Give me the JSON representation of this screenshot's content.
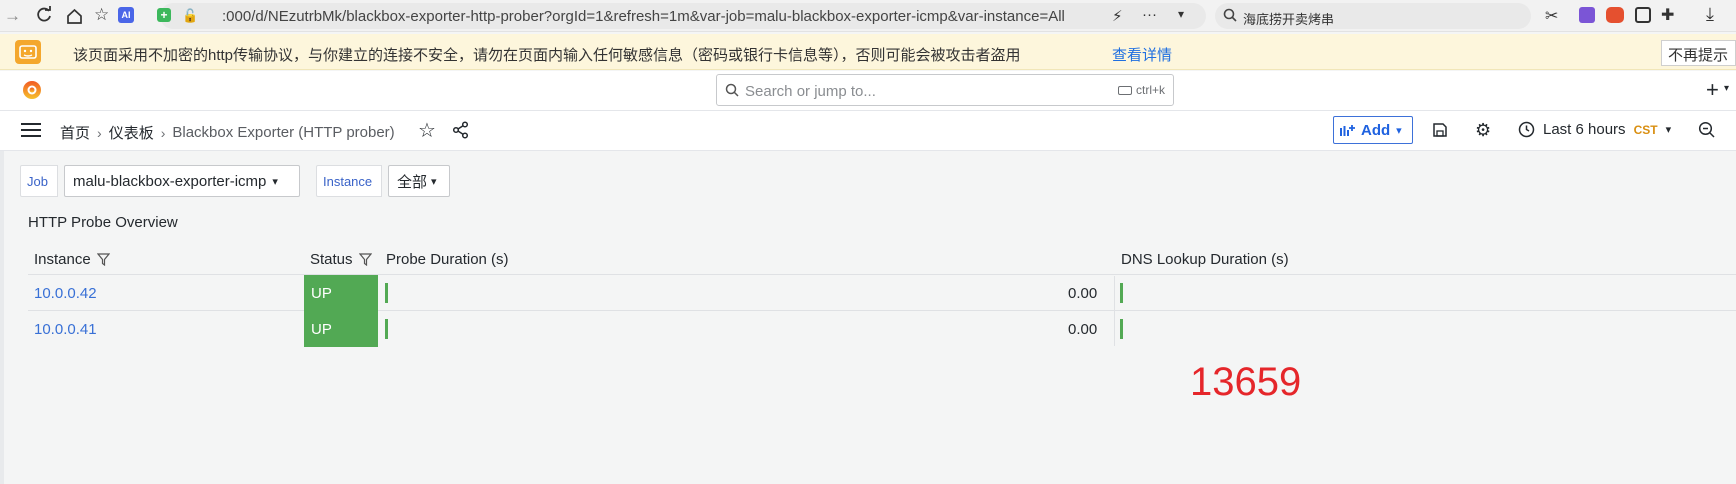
{
  "browser": {
    "url": ":000/d/NEzutrbMk/blackbox-exporter-http-prober?orgId=1&refresh=1m&var-job=malu-blackbox-exporter-icmp&var-instance=All",
    "search_text": "海底捞开卖烤串",
    "ai_badge": "AI"
  },
  "warning": {
    "message": "该页面采用不加密的http传输协议，与你建立的连接不安全，请勿在页面内输入任何敏感信息（密码或银行卡信息等），否则可能会被攻击者盗用",
    "link": "查看详情",
    "dismiss": "不再提示"
  },
  "topbar": {
    "search_placeholder": "Search or jump to...",
    "search_shortcut": "ctrl+k",
    "new_label": "+"
  },
  "breadcrumb": {
    "home": "首页",
    "dashboards": "仪表板",
    "current": "Blackbox Exporter (HTTP prober)"
  },
  "toolbar": {
    "add_label": "Add",
    "time_range": "Last 6 hours",
    "timezone": "CST"
  },
  "variables": {
    "job_label": "Job",
    "job_value": "malu-blackbox-exporter-icmp",
    "instance_label": "Instance",
    "instance_value": "全部"
  },
  "panel": {
    "title": "HTTP Probe Overview",
    "columns": [
      "Instance",
      "Status",
      "Probe Duration (s)",
      "DNS Lookup Duration (s)"
    ],
    "rows": [
      {
        "instance": "10.0.0.42",
        "status": "UP",
        "probe_duration": "0.00"
      },
      {
        "instance": "10.0.0.41",
        "status": "UP",
        "probe_duration": "0.00"
      }
    ]
  },
  "overlay_number": "13659",
  "colors": {
    "status_up": "#52a954",
    "link": "#3870d6",
    "warning_bg": "#fdf6dc",
    "overlay": "#e5262a"
  }
}
